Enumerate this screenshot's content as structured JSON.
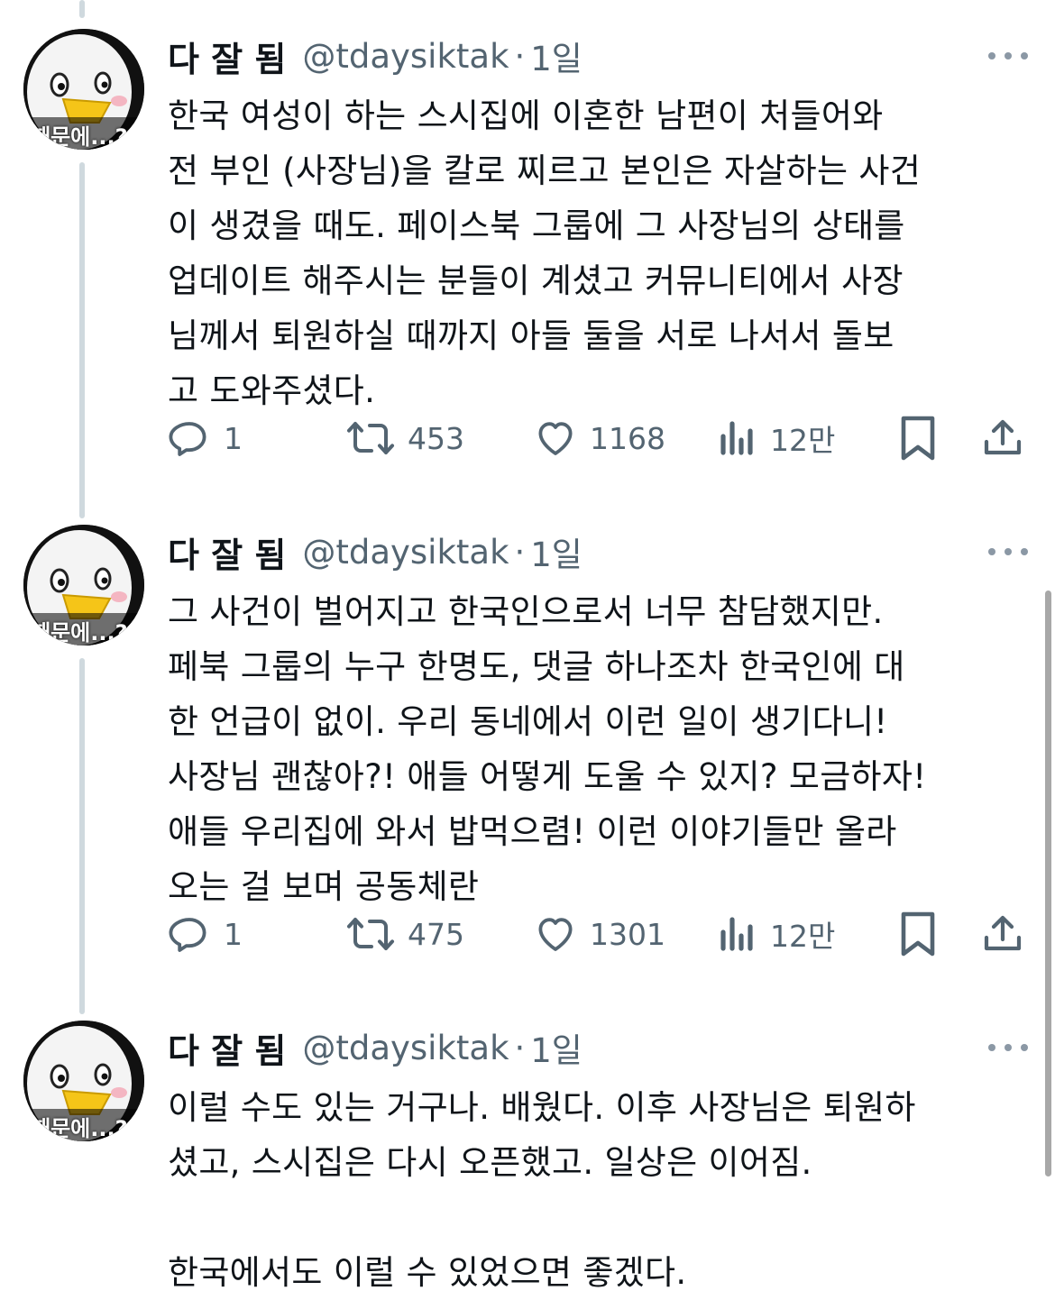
{
  "tweets": [
    {
      "author": {
        "name": "다 잘 됨",
        "handle": "@tdaysiktak",
        "avatar_caption": "때문에...?"
      },
      "time": "1일",
      "text": "한국 여성이 하는 스시집에 이혼한 남편이 처들어와\n전 부인 (사장님)을 칼로 찌르고 본인은 자살하는 사건\n이 생겼을 때도. 페이스북 그룹에 그 사장님의 상태를\n업데이트 해주시는 분들이 계셨고 커뮤니티에서 사장\n님께서 퇴원하실 때까지 아들 둘을 서로 나서서 돌보\n고 도와주셨다.",
      "stats": {
        "replies": "1",
        "reposts": "453",
        "likes": "1168",
        "views": "12만"
      }
    },
    {
      "author": {
        "name": "다 잘 됨",
        "handle": "@tdaysiktak",
        "avatar_caption": "때문에...?"
      },
      "time": "1일",
      "text": "그 사건이 벌어지고 한국인으로서 너무 참담했지만.\n페북 그룹의 누구 한명도, 댓글 하나조차 한국인에 대\n한 언급이 없이. 우리 동네에서 이런 일이 생기다니!\n사장님 괜찮아?! 애들 어떻게 도울 수 있지? 모금하자!\n애들 우리집에 와서 밥먹으렴! 이런 이야기들만 올라\n오는 걸 보며 공동체란",
      "stats": {
        "replies": "1",
        "reposts": "475",
        "likes": "1301",
        "views": "12만"
      }
    },
    {
      "author": {
        "name": "다 잘 됨",
        "handle": "@tdaysiktak",
        "avatar_caption": "때문에...?"
      },
      "time": "1일",
      "text": "이럴 수도 있는 거구나. 배웠다. 이후 사장님은 퇴원하\n셨고, 스시집은 다시 오픈했고. 일상은 이어짐.\n\n한국에서도 이럴 수 있었으면 좋겠다."
    }
  ],
  "colors": {
    "text": "#0f1419",
    "secondary": "#536471",
    "thread_line": "#cfd9de"
  },
  "icons": [
    "reply-icon",
    "repost-icon",
    "like-icon",
    "views-icon",
    "bookmark-icon",
    "share-icon",
    "more-icon"
  ]
}
